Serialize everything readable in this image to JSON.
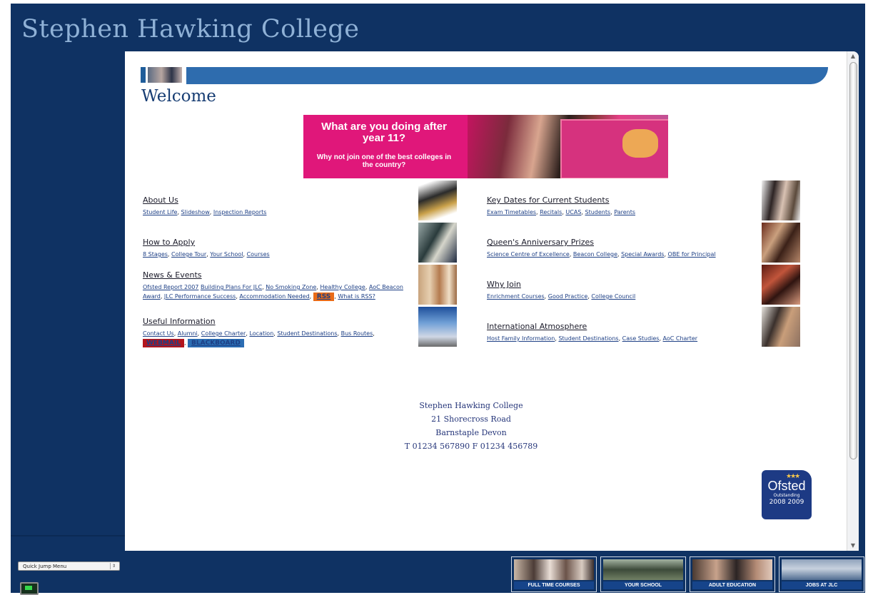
{
  "header": {
    "site_title": "Stephen Hawking College"
  },
  "welcome_heading": "Welcome",
  "banner": {
    "headline": "What are you doing after year 11?",
    "subline": "Why not join one of the best colleges in the country?"
  },
  "left_sections": [
    {
      "title": "About Us",
      "links": [
        "Student Life",
        "Slideshow",
        "Inspection Reports"
      ]
    },
    {
      "title": "How to Apply",
      "links": [
        "8 Stages",
        "College Tour",
        "Your School",
        "Courses"
      ]
    },
    {
      "title": "News & Events",
      "links": [
        "Ofsted Report 2007",
        "Building Plans For JLC",
        "No Smoking Zone",
        "Healthy College",
        "AoC Beacon Award",
        "JLC Performance Success",
        "Accommodation Needed"
      ],
      "badge": "RSS",
      "after_badge": "What is RSS?"
    },
    {
      "title": "Useful Information",
      "links": [
        "Contact Us",
        "Alumni",
        "College Charter",
        "Location",
        "Student Destinations",
        "Bus Routes"
      ],
      "badges": [
        "WEBMAIL",
        "BLACKBOARD"
      ]
    }
  ],
  "right_sections": [
    {
      "title": "Key Dates for Current Students",
      "links": [
        "Exam Timetables",
        "Recitals",
        "UCAS",
        "Students",
        "Parents"
      ]
    },
    {
      "title": "Queen's Anniversary Prizes",
      "links": [
        "Science Centre of Excellence",
        "Beacon College",
        "Special Awards",
        "OBE for Principal"
      ]
    },
    {
      "title": "Why Join",
      "links": [
        "Enrichment Courses",
        "Good Practice",
        "College Council"
      ]
    },
    {
      "title": "International Atmosphere",
      "links": [
        "Host Family Information",
        "Student Destinations",
        "Case Studies",
        "AoC Charter"
      ]
    }
  ],
  "address": {
    "name": "Stephen Hawking College",
    "street": "21 Shorecross Road",
    "town": "Barnstaple Devon",
    "phone": "T 01234 567890 F 01234 456789"
  },
  "ofsted": {
    "name": "Ofsted",
    "grade": "Outstanding",
    "years": "2008 2009"
  },
  "footer": {
    "quick_jump": "Quick Jump Menu",
    "nav": [
      "FULL TIME COURSES",
      "YOUR SCHOOL",
      "ADULT EDUCATION",
      "JOBS AT JLC"
    ]
  },
  "colors": {
    "frame": "#0f3263",
    "title": "#8fb1d6",
    "accent_bar": "#2e6cae",
    "banner": "#e0177a",
    "rss": "#e96b18",
    "webmail": "#b3151d",
    "blackboard": "#2b6db3"
  }
}
